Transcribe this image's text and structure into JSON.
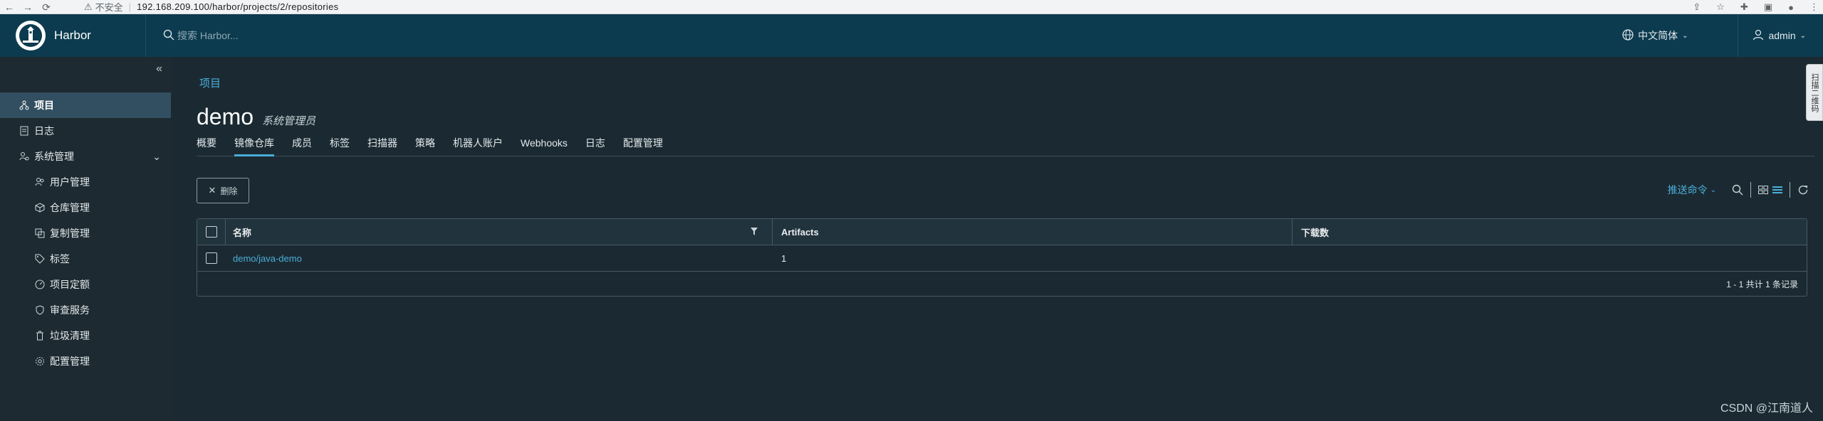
{
  "browser": {
    "security_label": "不安全",
    "url": "192.168.209.100/harbor/projects/2/repositories"
  },
  "header": {
    "brand": "Harbor",
    "search_placeholder": "搜索 Harbor...",
    "language": "中文简体",
    "user": "admin"
  },
  "sidebar": {
    "items": [
      {
        "label": "项目",
        "icon": "projects-icon",
        "active": true
      },
      {
        "label": "日志",
        "icon": "logs-icon"
      },
      {
        "label": "系统管理",
        "icon": "admin-icon",
        "expandable": true
      },
      {
        "label": "用户管理",
        "icon": "users-icon",
        "sub": true
      },
      {
        "label": "仓库管理",
        "icon": "registry-icon",
        "sub": true
      },
      {
        "label": "复制管理",
        "icon": "replication-icon",
        "sub": true
      },
      {
        "label": "标签",
        "icon": "tag-icon",
        "sub": true
      },
      {
        "label": "项目定额",
        "icon": "quota-icon",
        "sub": true
      },
      {
        "label": "审查服务",
        "icon": "shield-icon",
        "sub": true
      },
      {
        "label": "垃圾清理",
        "icon": "trash-icon",
        "sub": true
      },
      {
        "label": "配置管理",
        "icon": "gear-icon",
        "sub": true
      }
    ]
  },
  "main": {
    "breadcrumb": "项目",
    "title": "demo",
    "subtitle": "系统管理员",
    "tabs": [
      {
        "label": "概要"
      },
      {
        "label": "镜像仓库",
        "active": true
      },
      {
        "label": "成员"
      },
      {
        "label": "标签"
      },
      {
        "label": "扫描器"
      },
      {
        "label": "策略"
      },
      {
        "label": "机器人账户"
      },
      {
        "label": "Webhooks"
      },
      {
        "label": "日志"
      },
      {
        "label": "配置管理"
      }
    ],
    "delete_label": "删除",
    "push_command_label": "推送命令",
    "table": {
      "columns": [
        "名称",
        "Artifacts",
        "下载数"
      ],
      "rows": [
        {
          "name": "demo/java-demo",
          "artifacts": "1",
          "downloads": ""
        }
      ],
      "footer": "1 - 1 共计 1 条记录"
    }
  },
  "float_tab": "扫描二维码",
  "watermark": "CSDN @江南道人",
  "colors": {
    "header_bg": "#0c3b4f",
    "page_bg": "#1b2a32",
    "accent": "#4aaed9",
    "active_nav_bg": "#324f61"
  }
}
